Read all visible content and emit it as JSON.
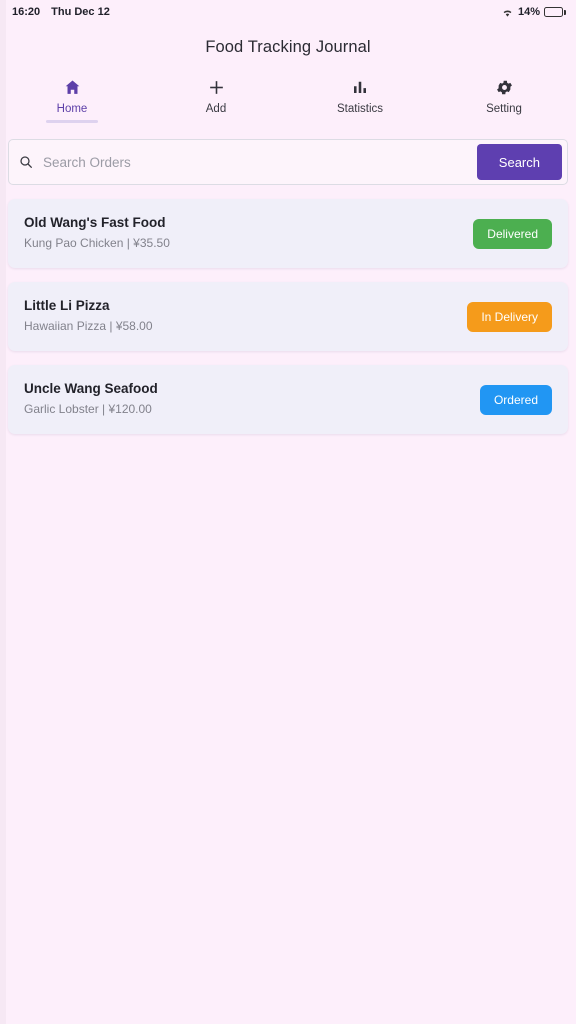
{
  "status_bar": {
    "time": "16:20",
    "date": "Thu Dec 12",
    "battery_percent": "14%",
    "wifi_icon": "wifi-icon",
    "battery_icon": "battery-icon"
  },
  "header": {
    "title": "Food Tracking Journal"
  },
  "tabs": [
    {
      "label": "Home",
      "icon": "home-icon",
      "active": true
    },
    {
      "label": "Add",
      "icon": "plus-icon",
      "active": false
    },
    {
      "label": "Statistics",
      "icon": "bar-chart-icon",
      "active": false
    },
    {
      "label": "Setting",
      "icon": "gear-icon",
      "active": false
    }
  ],
  "search": {
    "placeholder": "Search Orders",
    "value": "",
    "button_label": "Search",
    "icon": "search-icon"
  },
  "orders": [
    {
      "restaurant": "Old Wang's Fast Food",
      "details": "Kung Pao Chicken | ¥35.50",
      "status": "Delivered",
      "status_color": "#4caf50"
    },
    {
      "restaurant": "Little Li Pizza",
      "details": "Hawaiian Pizza | ¥58.00",
      "status": "In Delivery",
      "status_color": "#f59b1b"
    },
    {
      "restaurant": "Uncle Wang Seafood",
      "details": "Garlic Lobster | ¥120.00",
      "status": "Ordered",
      "status_color": "#2196f3"
    }
  ],
  "theme": {
    "background": "#fdeffb",
    "card_background": "#f0eff9",
    "accent_purple": "#5e3fb0"
  }
}
